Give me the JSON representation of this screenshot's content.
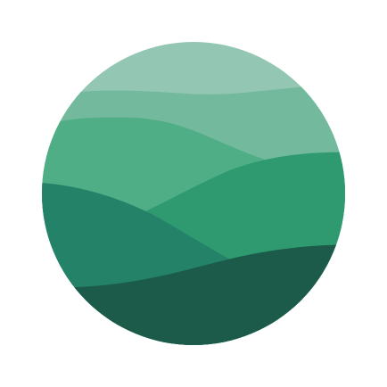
{
  "logo": {
    "name": "layered-hills-logo",
    "colors": {
      "background": "#ffffff",
      "band_1": "#93c6b3",
      "band_2": "#73b99d",
      "band_3": "#4fae85",
      "band_4": "#2f9a70",
      "band_5": "#248269",
      "band_6": "#1c5a4a"
    }
  }
}
